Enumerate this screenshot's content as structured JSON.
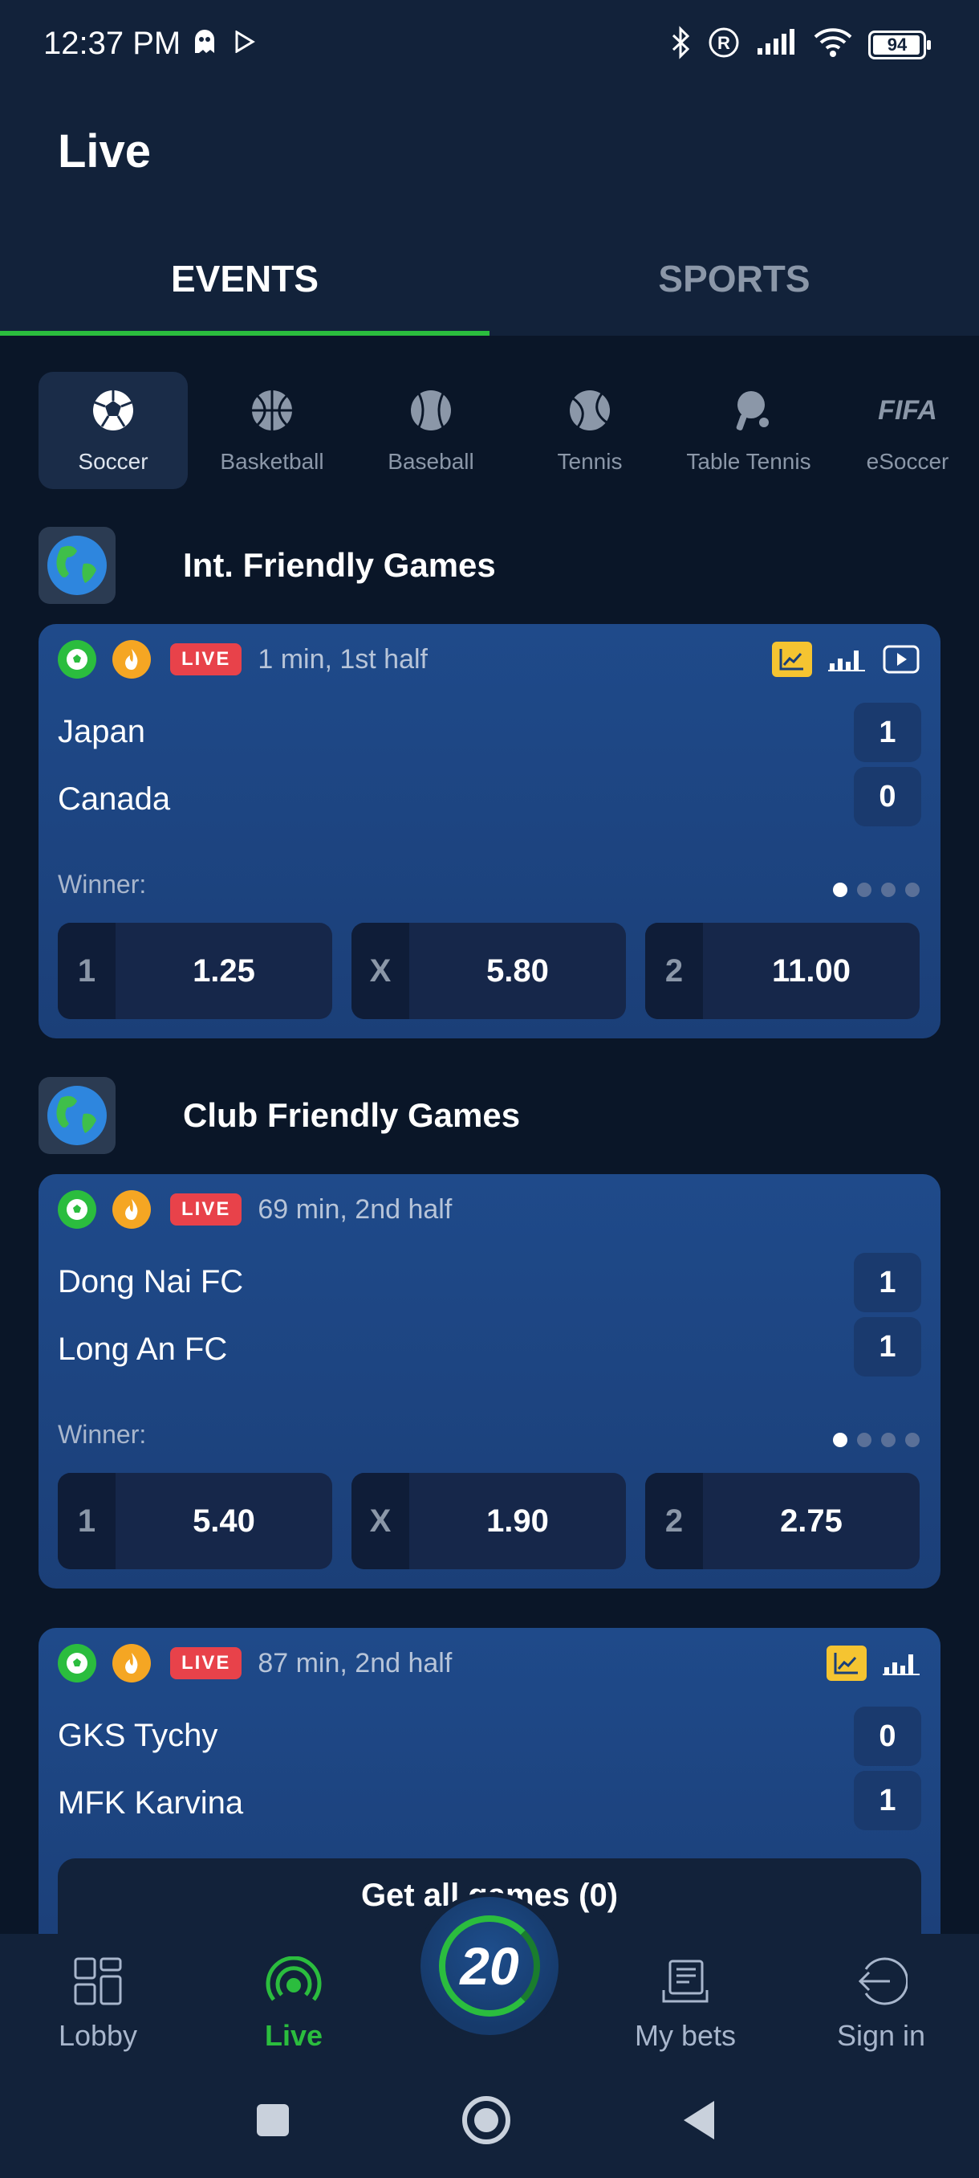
{
  "status_bar": {
    "time": "12:37 PM",
    "battery": "94"
  },
  "page": {
    "title": "Live"
  },
  "tabs": [
    {
      "label": "EVENTS",
      "active": true
    },
    {
      "label": "SPORTS",
      "active": false
    }
  ],
  "sports": [
    {
      "label": "Soccer",
      "icon": "soccer-ball-icon",
      "active": true
    },
    {
      "label": "Basketball",
      "icon": "basketball-icon"
    },
    {
      "label": "Baseball",
      "icon": "baseball-icon"
    },
    {
      "label": "Tennis",
      "icon": "tennis-ball-icon"
    },
    {
      "label": "Table Tennis",
      "icon": "ping-pong-icon"
    },
    {
      "label": "eSoccer",
      "icon_text": "FIFA"
    }
  ],
  "leagues": [
    {
      "name": "Int. Friendly Games",
      "matches": [
        {
          "live_label": "LIVE",
          "time": "1 min, 1st half",
          "home": "Japan",
          "away": "Canada",
          "home_score": "1",
          "away_score": "0",
          "market": "Winner:",
          "odds": [
            {
              "key": "1",
              "value": "1.25"
            },
            {
              "key": "X",
              "value": "5.80"
            },
            {
              "key": "2",
              "value": "11.00"
            }
          ]
        }
      ]
    },
    {
      "name": "Club Friendly Games",
      "matches": [
        {
          "live_label": "LIVE",
          "time": "69 min, 2nd half",
          "home": "Dong Nai FC",
          "away": "Long An FC",
          "home_score": "1",
          "away_score": "1",
          "market": "Winner:",
          "odds": [
            {
              "key": "1",
              "value": "5.40"
            },
            {
              "key": "X",
              "value": "1.90"
            },
            {
              "key": "2",
              "value": "2.75"
            }
          ]
        },
        {
          "live_label": "LIVE",
          "time": "87 min, 2nd half",
          "home": "GKS Tychy",
          "away": "MFK Karvina",
          "home_score": "0",
          "away_score": "1"
        }
      ]
    }
  ],
  "get_all": "Get all games (0)",
  "nav": {
    "lobby": "Lobby",
    "live": "Live",
    "center": "20",
    "my_bets": "My bets",
    "sign_in": "Sign in"
  },
  "colors": {
    "accent": "#2bbd3e",
    "live": "#e8424a",
    "card": "#1f4a8a"
  }
}
